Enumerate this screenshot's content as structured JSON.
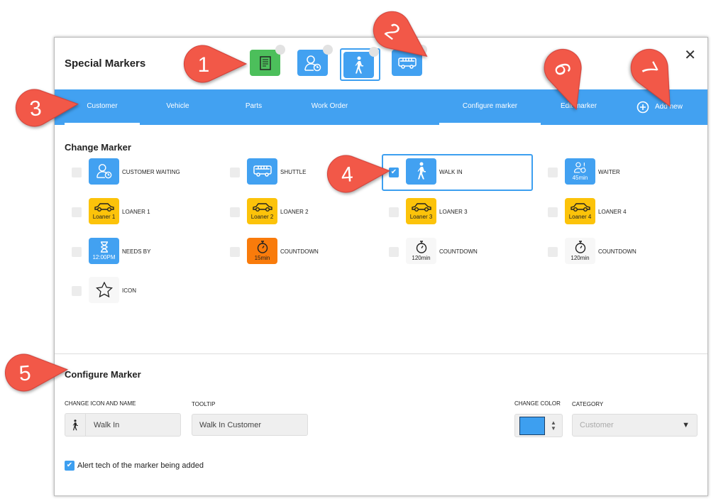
{
  "dialog": {
    "title": "Special Markers",
    "close_icon": "close-icon"
  },
  "top_markers": [
    {
      "icon": "document-icon",
      "color": "#4cbf5b"
    },
    {
      "icon": "customer-waiting-icon",
      "color": "#42a1f1"
    },
    {
      "icon": "walk-in-icon",
      "color": "#42a1f1",
      "selected": true
    },
    {
      "icon": "shuttle-icon",
      "color": "#42a1f1"
    }
  ],
  "tabs": [
    {
      "label": "Customer",
      "active": true
    },
    {
      "label": "Vehicle"
    },
    {
      "label": "Parts"
    },
    {
      "label": "Work Order"
    }
  ],
  "right_tabs": [
    {
      "label": "Configure marker",
      "active": true
    },
    {
      "label": "Edit marker"
    },
    {
      "label": "Add new"
    }
  ],
  "change_marker": {
    "heading": "Change Marker",
    "items": [
      {
        "label": "CUSTOMER WAITING",
        "icon": "customer-waiting-icon",
        "style": "blue",
        "badge": ""
      },
      {
        "label": "SHUTTLE",
        "icon": "shuttle-icon",
        "style": "blue",
        "badge": ""
      },
      {
        "label": "WALK IN",
        "icon": "walk-in-icon",
        "style": "blue",
        "badge": "",
        "checked": true
      },
      {
        "label": "WAITER",
        "icon": "waiter-icon",
        "style": "blue",
        "badge": "45min"
      },
      {
        "label": "LOANER 1",
        "icon": "car-icon",
        "style": "yel",
        "badge": "Loaner 1"
      },
      {
        "label": "LOANER 2",
        "icon": "car-icon",
        "style": "yel",
        "badge": "Loaner 2"
      },
      {
        "label": "LOANER 3",
        "icon": "car-icon",
        "style": "yel",
        "badge": "Loaner 3"
      },
      {
        "label": "LOANER 4",
        "icon": "car-icon",
        "style": "yel",
        "badge": "Loaner 4"
      },
      {
        "label": "NEEDS BY",
        "icon": "hourglass-icon",
        "style": "blue",
        "badge": "12:00PM"
      },
      {
        "label": "COUNTDOWN",
        "icon": "stopwatch-icon",
        "style": "org",
        "badge": "15min"
      },
      {
        "label": "COUNTDOWN",
        "icon": "stopwatch-icon",
        "style": "plain",
        "badge": "120min"
      },
      {
        "label": "COUNTDOWN",
        "icon": "stopwatch-icon",
        "style": "plain",
        "badge": "120min"
      },
      {
        "label": "ICON",
        "icon": "star-icon",
        "style": "plain",
        "badge": ""
      }
    ]
  },
  "configure": {
    "heading": "Configure Marker",
    "icon_name_label": "CHANGE ICON AND NAME",
    "name_value": "Walk In",
    "tooltip_label": "TOOLTIP",
    "tooltip_value": "Walk In Customer",
    "color_label": "CHANGE COLOR",
    "color_value": "#3d9ff0",
    "category_label": "CATEGORY",
    "category_value": "Customer",
    "alert_label": "Alert tech of the marker being added",
    "alert_checked": true
  },
  "annotations": [
    "1",
    "2",
    "3",
    "4",
    "5",
    "6",
    "7"
  ],
  "annotation_color": "#f25848"
}
